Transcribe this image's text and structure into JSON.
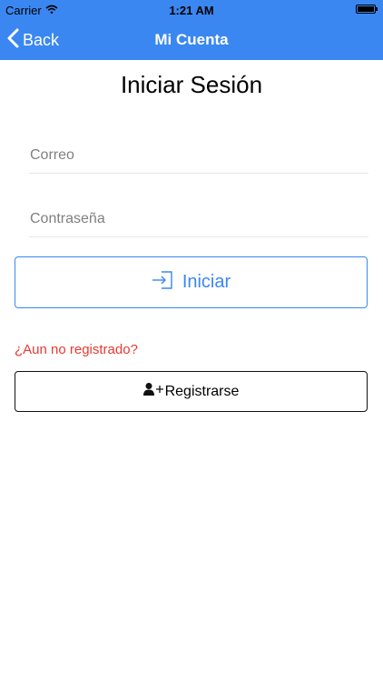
{
  "status_bar": {
    "carrier": "Carrier",
    "time": "1:21 AM",
    "battery_level": 1.0
  },
  "nav": {
    "back_label": "Back",
    "title": "Mi Cuenta",
    "background_color": "#3b87f1"
  },
  "page": {
    "title": "Iniciar Sesión"
  },
  "form": {
    "email_placeholder": "Correo",
    "email_value": "",
    "password_placeholder": "Contraseña",
    "password_value": "",
    "login_label": "Iniciar",
    "login_icon": "sign-in-icon",
    "accent_color": "#3b87f1"
  },
  "register": {
    "prompt": "¿Aun no registrado?",
    "prompt_color": "#e53a33",
    "button_label": "Registrarse",
    "button_icon": "add-user-icon"
  }
}
